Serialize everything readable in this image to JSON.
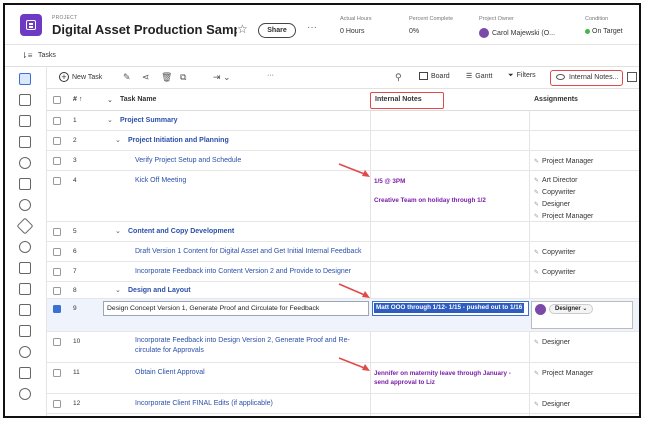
{
  "header": {
    "project_label": "PROJECT",
    "title": "Digital Asset Production Samp...",
    "share_label": "Share",
    "more_label": "···",
    "fields": [
      {
        "label": "Actual Hours",
        "value": "0 Hours"
      },
      {
        "label": "Percent Complete",
        "value": "0%"
      },
      {
        "label": "Project Owner",
        "value": "Carol Majewski (O..."
      },
      {
        "label": "Condition",
        "value": "On Target"
      }
    ],
    "condition_color": "#47b64a",
    "brand_color": "#6e3ac4"
  },
  "tasks_bar": {
    "label": "Tasks"
  },
  "toolbar": {
    "new_task": "New Task",
    "more": "···",
    "board": "Board",
    "gantt": "Gantt",
    "filters": "Filters",
    "internal_notes": "Internal Notes..."
  },
  "columns": {
    "num": "#",
    "task_name": "Task Name",
    "internal_notes": "Internal Notes",
    "assignments": "Assignments"
  },
  "rows": [
    {
      "num": "1",
      "name": "Project Summary",
      "notes": [],
      "assignments": []
    },
    {
      "num": "2",
      "name": "Project Initiation and Planning",
      "notes": [],
      "assignments": []
    },
    {
      "num": "3",
      "name": "Verify Project Setup and Schedule",
      "notes": [],
      "assignments": [
        "Project Manager"
      ]
    },
    {
      "num": "4",
      "name": "Kick Off Meeting",
      "notes": [
        "1/5 @ 3PM",
        "Creative Team on holiday through 1/2"
      ],
      "assignments": [
        "Art Director",
        "Copywriter",
        "Designer",
        "Project Manager"
      ]
    },
    {
      "num": "5",
      "name": "Content and Copy Development",
      "notes": [],
      "assignments": []
    },
    {
      "num": "6",
      "name": "Draft Version 1 Content for Digital Asset and Get Initial Internal Feedback",
      "notes": [],
      "assignments": [
        "Copywriter"
      ]
    },
    {
      "num": "7",
      "name": "Incorporate Feedback into Content Version 2 and Provide to Designer",
      "notes": [],
      "assignments": [
        "Copywriter"
      ]
    },
    {
      "num": "8",
      "name": "Design and Layout",
      "notes": [],
      "assignments": []
    },
    {
      "num": "9",
      "name": "Design Concept Version 1, Generate Proof and Circulate for Feedback",
      "notes": [
        "Matt OOO through 1/12- 1/15 - pushed out to 1/16"
      ],
      "assignments": [
        "Designer"
      ]
    },
    {
      "num": "10",
      "name": [
        "Incorporate Feedback into Design Version 2, Generate Proof and Re-",
        "circulate for Approvals"
      ],
      "notes": [],
      "assignments": [
        "Designer"
      ]
    },
    {
      "num": "11",
      "name": "Obtain Client Approval",
      "notes": [
        "Jennifer on maternity leave through January -",
        "send approval to Liz"
      ],
      "assignments": [
        "Project Manager"
      ]
    },
    {
      "num": "12",
      "name": "Incorporate Client FINAL Edits (if applicable)",
      "notes": [],
      "assignments": [
        "Designer"
      ]
    }
  ],
  "highlight_color": "#e04a4a",
  "note_color": "#7a1fa8",
  "link_color": "#2b4fa8",
  "icons": [
    "project-icon",
    "star-icon",
    "more-icon",
    "tasks-icon",
    "new-task-plus-icon",
    "edit-icon",
    "share-icon",
    "delete-icon",
    "copy-icon",
    "indent-icon",
    "search-icon",
    "board-icon",
    "gantt-icon",
    "filter-icon",
    "eye-icon",
    "grid-icon",
    "chevron-down-icon",
    "pencil-icon",
    "arrow-icon"
  ]
}
